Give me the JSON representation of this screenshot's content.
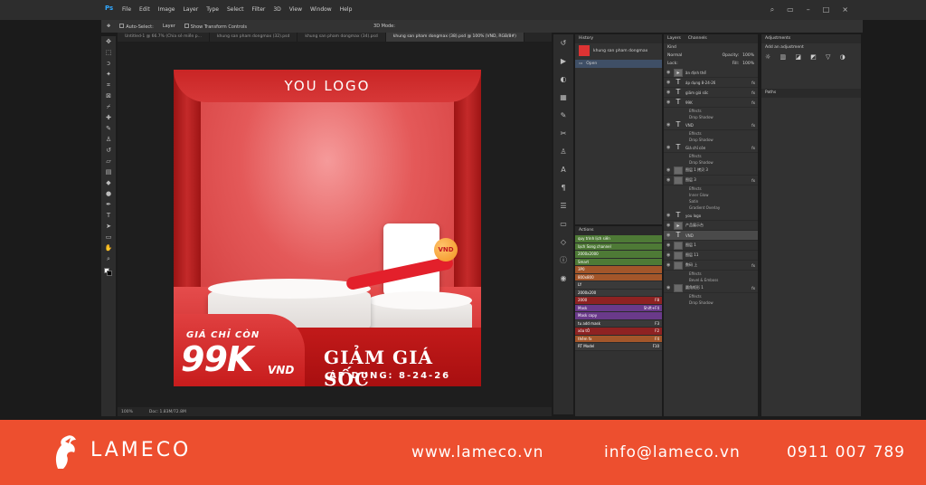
{
  "app": {
    "logo": "Ps",
    "menu": [
      "File",
      "Edit",
      "Image",
      "Layer",
      "Type",
      "Select",
      "Filter",
      "3D",
      "View",
      "Window",
      "Help"
    ]
  },
  "options_bar": {
    "auto_select": "Auto-Select:",
    "auto_select_value": "Layer",
    "show_transform": "Show Transform Controls",
    "mode_3d": "3D Mode:"
  },
  "doc_tabs": [
    "Untitled-1 @ 66.7% (Chia sẻ miễn p...",
    "khung san pham dongmax (32).psd",
    "khung san pham dongmax (34).psd",
    "khung san pham dongmax (38).psd @ 100% (VND, RGB/8#)"
  ],
  "status": {
    "zoom": "100%",
    "doc": "Doc: 1.83M/72.8M"
  },
  "artwork": {
    "logo": "YOU LOGO",
    "badge": "VND",
    "gia_chi_con": "GIÁ CHỈ CÒN",
    "price": "99K",
    "currency": "VND",
    "headline": "GIẢM GIÁ SỐC",
    "apply_date": "ÁP DỤNG: 8-24-26"
  },
  "history": {
    "tabs": [
      "History"
    ],
    "doc_name": "khung san pham dongmax",
    "step": "Open"
  },
  "actions": {
    "tab": "Actions",
    "items": [
      {
        "name": "quy trình lịch siến",
        "key": "",
        "color": "#4e7a36"
      },
      {
        "name": "lạch Song channel",
        "key": "",
        "color": "#4e7a36"
      },
      {
        "name": "2000x2000",
        "key": "",
        "color": "#4e7a36"
      },
      {
        "name": "Smart",
        "key": "",
        "color": "#4e7a36"
      },
      {
        "name": "3P0",
        "key": "",
        "color": "#a3562a"
      },
      {
        "name": "800x800",
        "key": "",
        "color": "#a3562a"
      },
      {
        "name": "LY",
        "key": "",
        "color": "#3a3a3a"
      },
      {
        "name": "2000x200",
        "key": "",
        "color": "#3a3a3a"
      },
      {
        "name": "2000",
        "key": "F8",
        "color": "#8e2222"
      },
      {
        "name": "Mask",
        "key": "Shift+F4",
        "color": "#6a3a8a"
      },
      {
        "name": "Mask copy",
        "key": "",
        "color": "#6a3a8a"
      },
      {
        "name": "tu add mask",
        "key": "F3",
        "color": "#3a3a3a"
      },
      {
        "name": "xóa tÔ",
        "key": "F2",
        "color": "#8e2222"
      },
      {
        "name": "thêm fx",
        "key": "F4",
        "color": "#a3562a"
      },
      {
        "name": "RT Model",
        "key": "F10",
        "color": "#3a3a3a"
      }
    ]
  },
  "layers": {
    "tabs": [
      "Layers",
      "Channels"
    ],
    "kind": "Kind",
    "blend": "Normal",
    "opacity_label": "Opacity:",
    "opacity": "100%",
    "fill_label": "Fill:",
    "fill": "100%",
    "lock_label": "Lock:",
    "rows": [
      {
        "name": "ăn định thể",
        "type": "group",
        "fx": "",
        "sub": false
      },
      {
        "name": "áp dụng 8-24-26",
        "type": "text",
        "fx": "fx",
        "sub": false
      },
      {
        "name": "giảm giá sốc",
        "type": "text",
        "fx": "fx",
        "sub": false
      },
      {
        "name": "99K",
        "type": "text",
        "fx": "fx",
        "sub": false
      },
      {
        "name": "Effects",
        "type": "sub",
        "fx": "",
        "sub": true
      },
      {
        "name": "Drop Shadow",
        "type": "sub",
        "fx": "",
        "sub": true
      },
      {
        "name": "VND",
        "type": "text",
        "fx": "fx",
        "sub": false
      },
      {
        "name": "Effects",
        "type": "sub",
        "fx": "",
        "sub": true
      },
      {
        "name": "Drop Shadow",
        "type": "sub",
        "fx": "",
        "sub": true
      },
      {
        "name": "Giá chỉ còn",
        "type": "text",
        "fx": "fx",
        "sub": false
      },
      {
        "name": "Effects",
        "type": "sub",
        "fx": "",
        "sub": true
      },
      {
        "name": "Drop Shadow",
        "type": "sub",
        "fx": "",
        "sub": true
      },
      {
        "name": "图层 1 拷贝 3",
        "type": "image",
        "fx": "",
        "sub": false
      },
      {
        "name": "图层 3",
        "type": "image",
        "fx": "fx",
        "sub": false
      },
      {
        "name": "Effects",
        "type": "sub",
        "fx": "",
        "sub": true
      },
      {
        "name": "Inner Glow",
        "type": "sub",
        "fx": "",
        "sub": true
      },
      {
        "name": "Satin",
        "type": "sub",
        "fx": "",
        "sub": true
      },
      {
        "name": "Gradient Overlay",
        "type": "sub",
        "fx": "",
        "sub": true
      },
      {
        "name": "you logo",
        "type": "text",
        "fx": "",
        "sub": false
      },
      {
        "name": "产品展示台",
        "type": "group",
        "fx": "",
        "sub": false
      },
      {
        "name": "VND",
        "type": "text",
        "fx": "",
        "sub": false
      },
      {
        "name": "图层 1",
        "type": "image",
        "fx": "",
        "sub": false
      },
      {
        "name": "图层 11",
        "type": "image",
        "fx": "",
        "sub": false
      },
      {
        "name": "数码 上",
        "type": "image",
        "fx": "fx",
        "sub": false
      },
      {
        "name": "Effects",
        "type": "sub",
        "fx": "",
        "sub": true
      },
      {
        "name": "Bevel & Emboss",
        "type": "sub",
        "fx": "",
        "sub": true
      },
      {
        "name": "圆角矩形 1",
        "type": "image",
        "fx": "fx",
        "sub": false
      },
      {
        "name": "Effects",
        "type": "sub",
        "fx": "",
        "sub": true
      },
      {
        "name": "Drop Shadow",
        "type": "sub",
        "fx": "",
        "sub": true
      }
    ]
  },
  "adjustments": {
    "tab": "Adjustments",
    "hint": "Add an adjustment"
  },
  "paths": {
    "tab": "Paths"
  },
  "footer": {
    "brand": "LAMECO",
    "website": "www.lameco.vn",
    "email": "info@lameco.vn",
    "phone": "0911 007 789",
    "bg": "#ed4f2f"
  }
}
